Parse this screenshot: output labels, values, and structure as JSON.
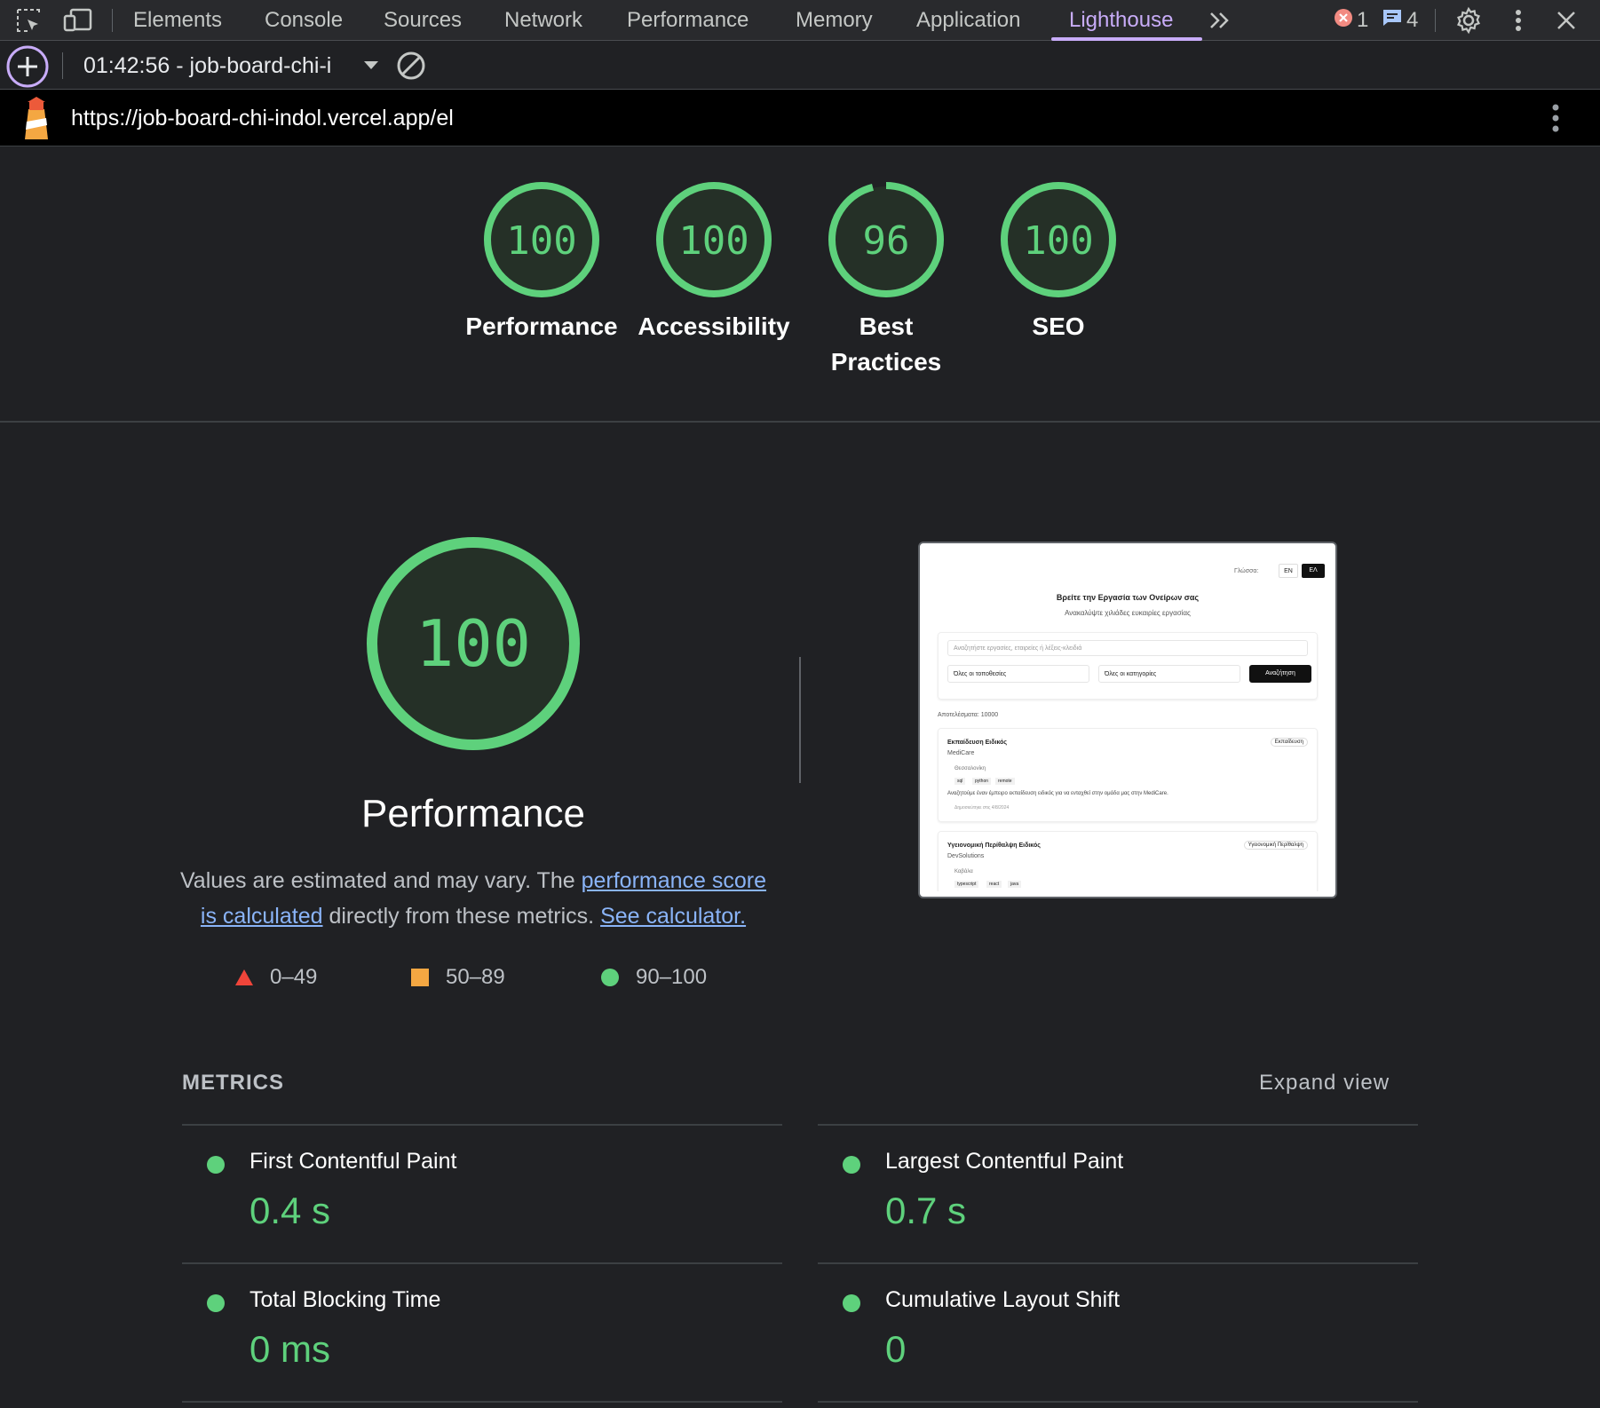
{
  "devtools": {
    "tabs": [
      "Elements",
      "Console",
      "Sources",
      "Network",
      "Performance",
      "Memory",
      "Application",
      "Lighthouse"
    ],
    "active_tab": "Lighthouse",
    "error_count": "1",
    "message_count": "4",
    "icons": [
      "inspect-element-icon",
      "device-toolbar-icon",
      "more-tabs-icon",
      "error-icon",
      "message-icon",
      "settings-icon",
      "kebab-menu-icon",
      "close-icon"
    ]
  },
  "toolbar": {
    "report_label": "01:42:56 - job-board-chi-i",
    "icons": [
      "new-report-icon",
      "dropdown-caret-icon",
      "clear-icon"
    ]
  },
  "urlbar": {
    "url": "https://job-board-chi-indol.vercel.app/el"
  },
  "scores": [
    {
      "label": "Performance",
      "value": "100",
      "score": 100
    },
    {
      "label": "Accessibility",
      "value": "100",
      "score": 100
    },
    {
      "label": "Best",
      "label2": "Practices",
      "value": "96",
      "score": 96
    },
    {
      "label": "SEO",
      "value": "100",
      "score": 100
    }
  ],
  "performance": {
    "score": "100",
    "title": "Performance",
    "desc_prefix": "Values are estimated and may vary. The ",
    "link1a": "performance score",
    "link1b": "is calculated",
    "desc_mid": " directly from these metrics. ",
    "link2": "See calculator.",
    "legend": [
      {
        "range": "0–49",
        "color": "#f0453a"
      },
      {
        "range": "50–89",
        "color": "#f4a742"
      },
      {
        "range": "90–100",
        "color": "#5ed17c"
      }
    ]
  },
  "screenshot": {
    "lang_label": "Γλώσσα:",
    "lang_en": "EN",
    "lang_el": "ΕΛ",
    "heading": "Βρείτε την Εργασία των Ονείρων σας",
    "subheading": "Ανακαλύψτε χιλιάδες ευκαιρίες εργασίας",
    "search_placeholder": "Αναζητήστε εργασίες, εταιρείες ή λέξεις-κλειδιά",
    "location_select": "Όλες οι τοποθεσίες",
    "category_select": "Όλες οι κατηγορίες",
    "search_button": "Αναζήτηση",
    "results": "Αποτελέσματα: 10000",
    "jobs": [
      {
        "title": "Εκπαίδευση Ειδικός",
        "company": "MediCare",
        "category": "Εκπαίδευση",
        "location": "Θεσσαλονίκη",
        "tags": [
          "sql",
          "python",
          "remote"
        ],
        "desc": "Αναζητούμε έναν έμπειρο εκπαίδευση ειδικός για να ενταχθεί στην ομάδα μας στην MediCare.",
        "date": "Δημοσιεύτηκε στις 4/8/2024"
      },
      {
        "title": "Υγειονομική Περίθαλψη Ειδικός",
        "company": "DevSolutions",
        "category": "Υγειονομική Περίθαλψη",
        "location": "Καβάλα",
        "tags": [
          "typescript",
          "react",
          "java"
        ]
      }
    ]
  },
  "metrics": {
    "heading": "METRICS",
    "expand": "Expand view",
    "items": [
      {
        "name": "First Contentful Paint",
        "value": "0.4 s"
      },
      {
        "name": "Largest Contentful Paint",
        "value": "0.7 s"
      },
      {
        "name": "Total Blocking Time",
        "value": "0 ms"
      },
      {
        "name": "Cumulative Layout Shift",
        "value": "0"
      }
    ]
  }
}
